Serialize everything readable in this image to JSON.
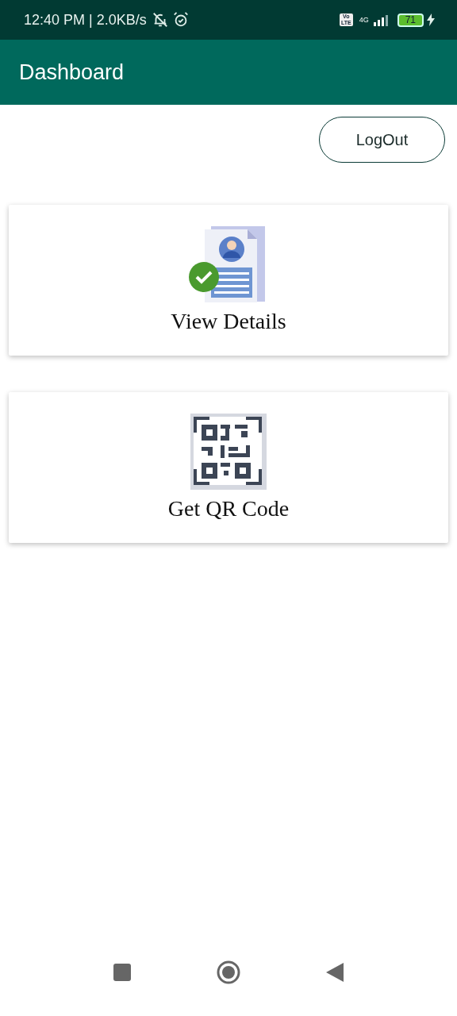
{
  "status_bar": {
    "time": "12:40 PM | 2.0KB/s",
    "volte": [
      "Vo",
      "LTE"
    ],
    "network": "4G",
    "battery": "71"
  },
  "app_bar": {
    "title": "Dashboard"
  },
  "logout_button": {
    "label": "LogOut"
  },
  "cards": [
    {
      "kind": "details",
      "label": "View Details"
    },
    {
      "kind": "qr",
      "label": "Get QR Code"
    }
  ]
}
